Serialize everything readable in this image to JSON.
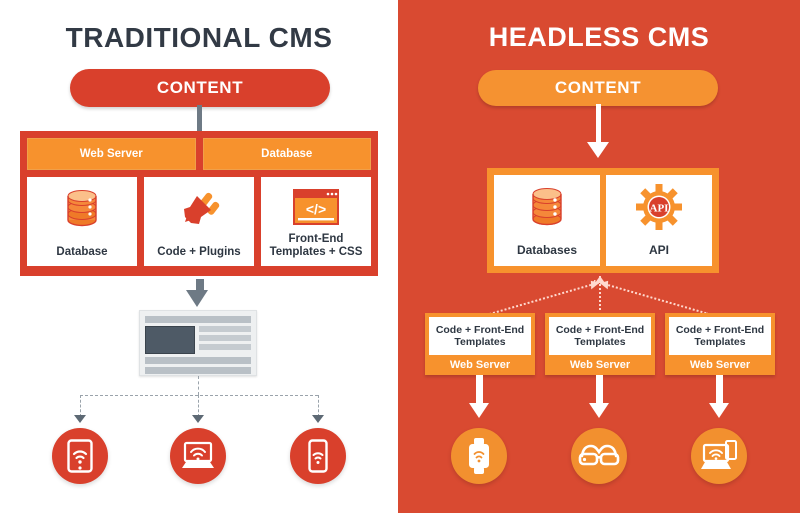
{
  "panels": {
    "left": {
      "title": "TRADITIONAL CMS",
      "content_pill": "CONTENT",
      "bars": [
        "Web Server",
        "Database"
      ],
      "cards": [
        {
          "label": "Database",
          "icon": "database-cylinder-icon"
        },
        {
          "label": "Code + Plugins",
          "icon": "plug-icon"
        },
        {
          "label": "Front-End\nTemplates + CSS",
          "icon": "code-window-icon"
        }
      ],
      "card_labels": [
        "Database",
        "Code + Plugins",
        "Front-End Templates + CSS"
      ],
      "output": "webpage-mockup",
      "devices": [
        {
          "name": "tablet-device-icon"
        },
        {
          "name": "laptop-device-icon"
        },
        {
          "name": "phone-device-icon"
        }
      ]
    },
    "right": {
      "title": "HEADLESS CMS",
      "content_pill": "CONTENT",
      "cards": [
        {
          "label": "Databases",
          "icon": "database-cylinder-icon"
        },
        {
          "label": "API",
          "icon": "api-gear-icon"
        }
      ],
      "api_glyph": "API",
      "servers": [
        {
          "top": "Code + Front-End Templates",
          "foot": "Web Server"
        },
        {
          "top": "Code + Front-End Templates",
          "foot": "Web Server"
        },
        {
          "top": "Code + Front-End Templates",
          "foot": "Web Server"
        }
      ],
      "devices": [
        {
          "name": "smartwatch-device-icon"
        },
        {
          "name": "smart-glasses-device-icon"
        },
        {
          "name": "laptop-tablet-device-icon"
        }
      ]
    }
  },
  "colors": {
    "red_panel": "#d94a31",
    "red_accent": "#d9402c",
    "orange": "#f7922d",
    "orange_light": "#f59231",
    "dark_text": "#2e3742",
    "gray_line": "#6e7a85"
  }
}
